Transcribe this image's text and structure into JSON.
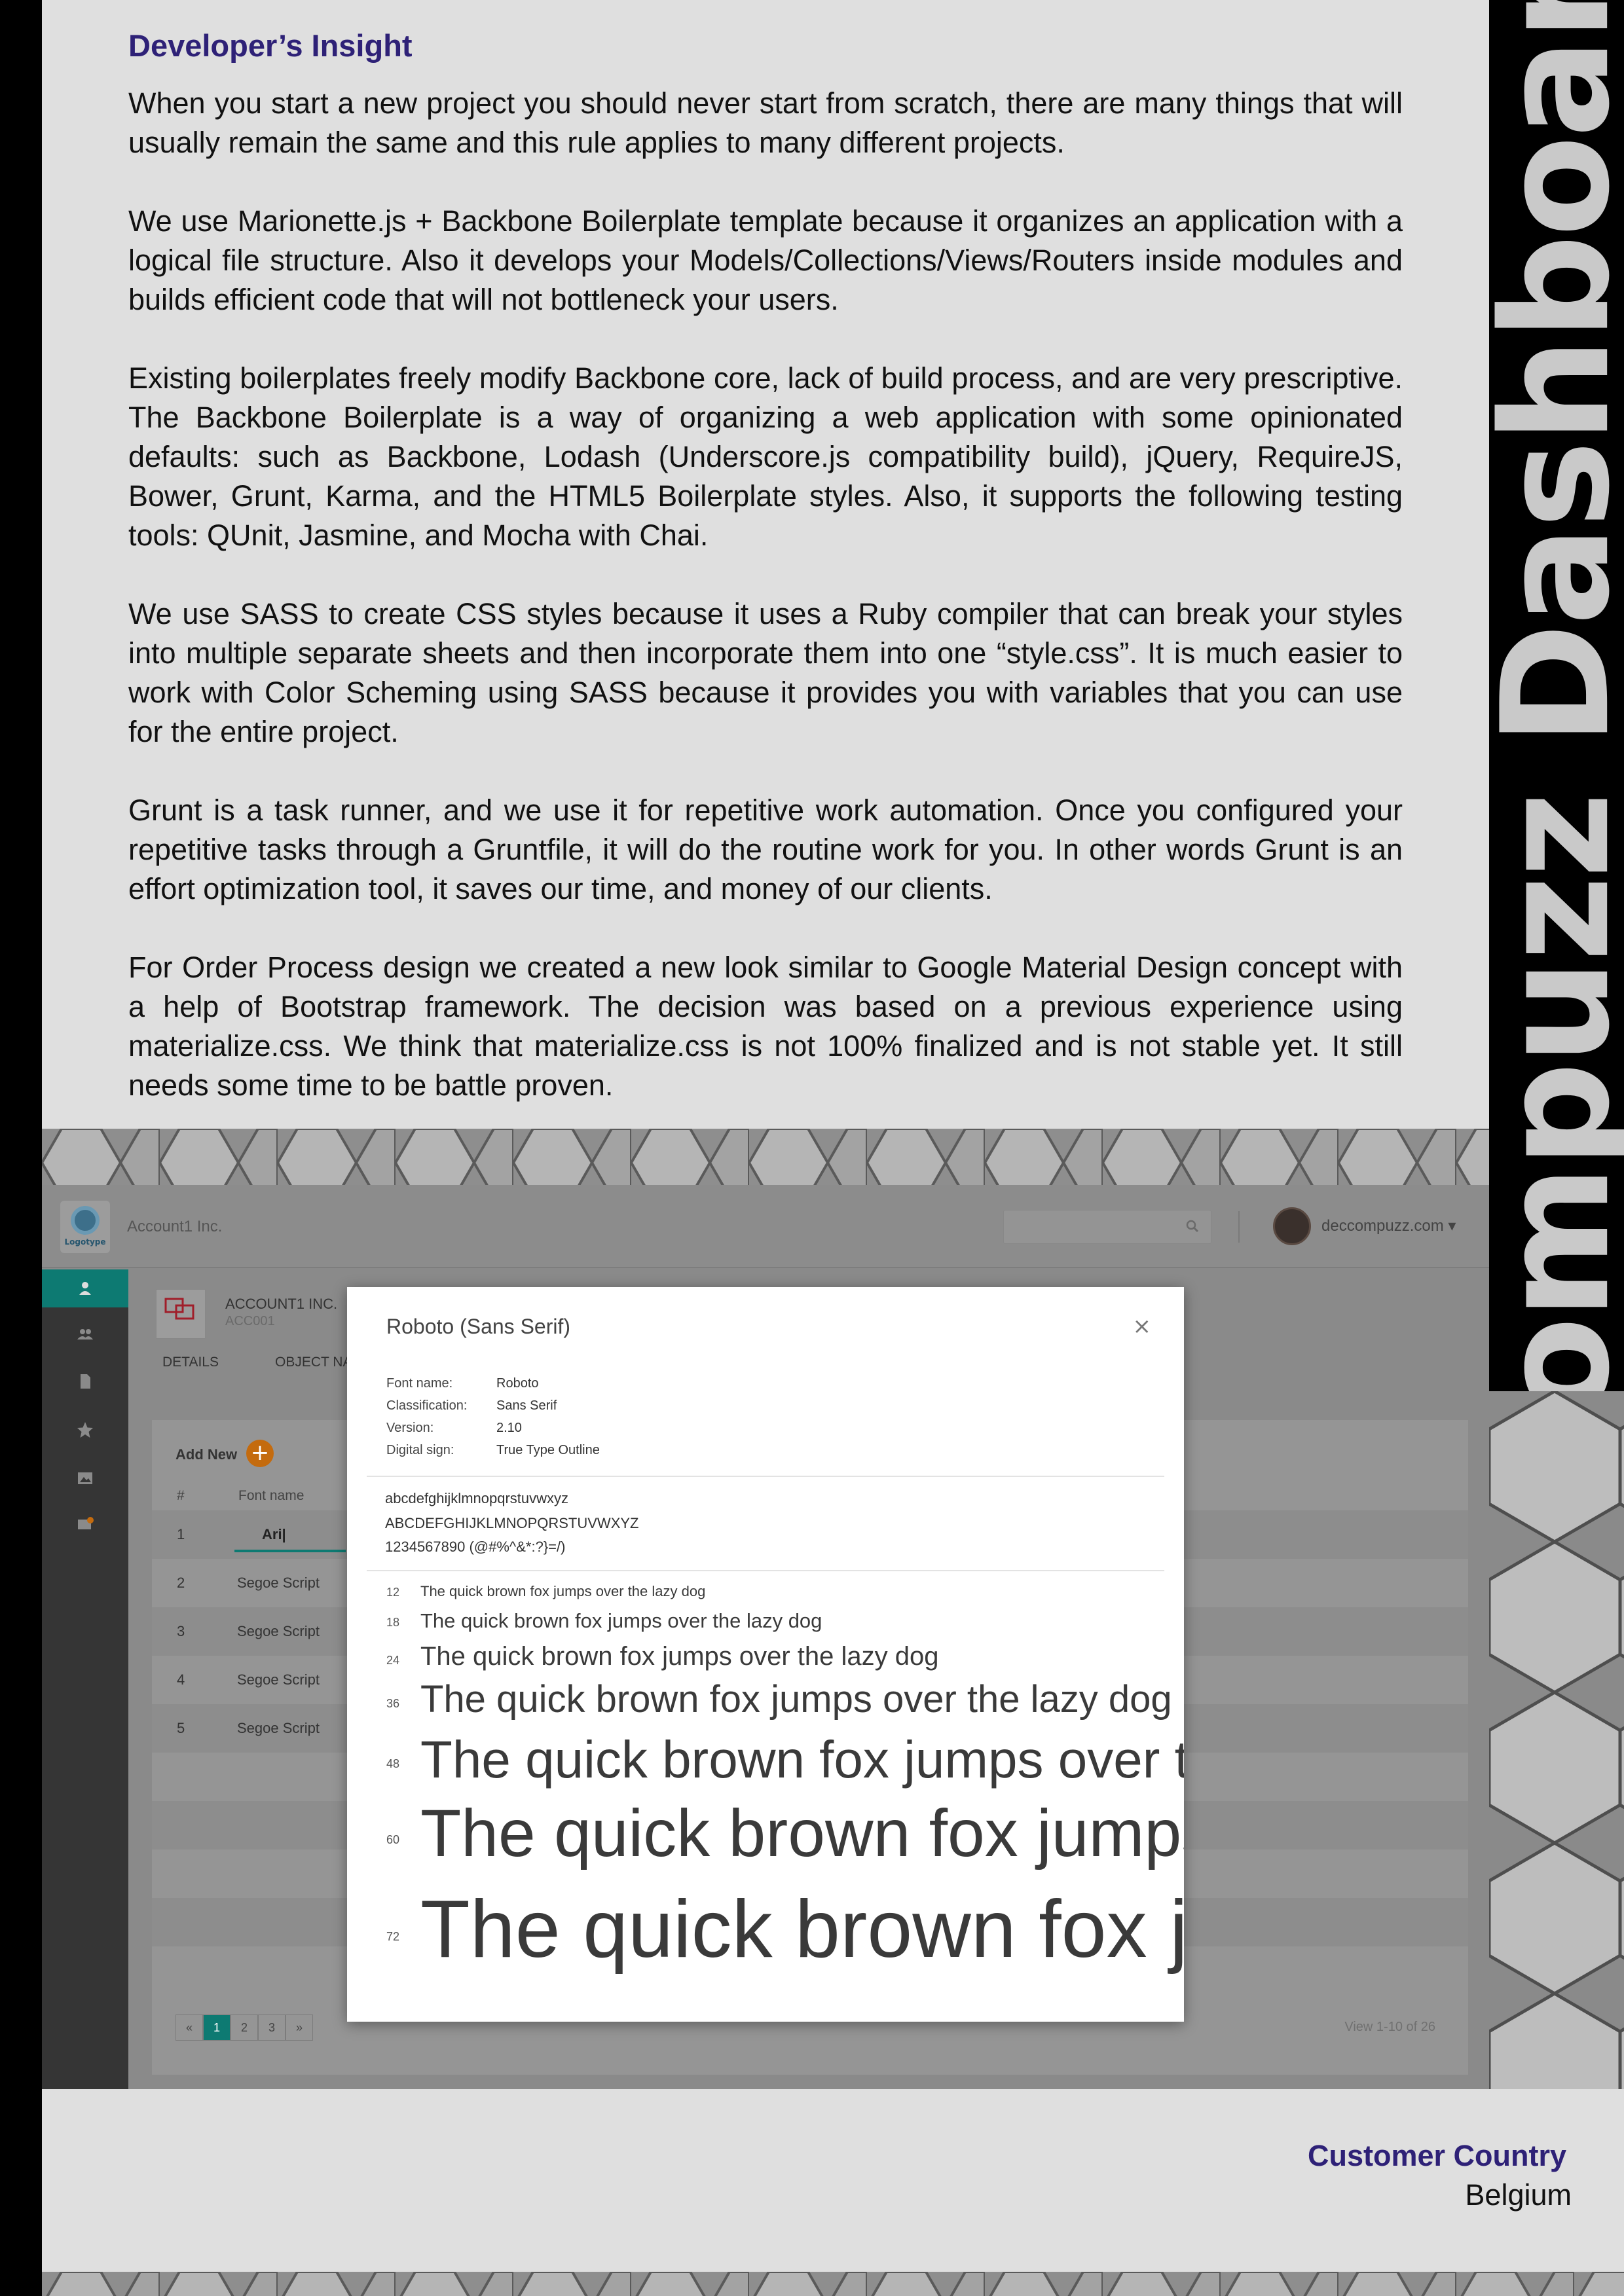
{
  "side_title": "Compuzz Dashboard",
  "insight": {
    "heading": "Developer’s Insight",
    "paragraphs": [
      "When you start a new project you should never start from scratch, there are many things that will usually remain the same and this rule applies to many different projects.",
      "We use Marionette.js + Backbone Boilerplate template because it organizes an application with a logical file structure. Also it develops your Models/Collections/Views/Routers inside modules and builds efficient code that will not bottleneck your users.",
      "Existing boilerplates freely modify Backbone core, lack of build process, and are very prescriptive. The Backbone Boilerplate is a way of organizing a web application with some opinionated defaults: such as Backbone, Lodash (Underscore.js compatibility build), jQuery, RequireJS, Bower, Grunt, Karma, and the HTML5 Boilerplate styles. Also, it supports the following testing tools: QUnit, Jasmine, and Mocha with Chai.",
      "We use SASS to create CSS styles because it uses a Ruby compiler that can break your styles into multiple separate sheets and then incorporate them into one “style.css”. It is much easier to work with Color Scheming using SASS because it provides you with variables that you can use for the entire project.",
      "Grunt is a task runner, and we use it for repetitive work automation. Once you configured your repetitive tasks through a Gruntfile, it will do the routine work for you. In other words Grunt is an effort optimization tool, it saves our time, and money of our clients.",
      "For Order Process design we created a new look similar to Google Material Design concept with a help of Bootstrap framework. The decision was based on a previous experience using materialize.css. We think that  materialize.css is not 100% finalized and is not stable yet. It still needs some time to be battle proven."
    ]
  },
  "dashboard": {
    "logo_text": "Logotype",
    "account_name": "Account1 Inc.",
    "user_name": "deccompuzz.com ▾",
    "account_title": "ACCOUNT1 INC.",
    "account_code": "ACC001",
    "tabs": [
      "DETAILS",
      "OBJECT NA"
    ],
    "add_new": "Add New",
    "columns": [
      "#",
      "Font name"
    ],
    "input_value": "Ari|",
    "rows": [
      {
        "num": "1",
        "font": ""
      },
      {
        "num": "2",
        "font": "Segoe Script"
      },
      {
        "num": "3",
        "font": "Segoe Script"
      },
      {
        "num": "4",
        "font": "Segoe Script"
      },
      {
        "num": "5",
        "font": "Segoe Script"
      }
    ],
    "pagination": [
      "«",
      "1",
      "2",
      "3",
      "»"
    ],
    "view_count": "View 1-10 of 26",
    "colors": {
      "accent": "#0d7a72",
      "add_button": "#c46b0e"
    }
  },
  "modal": {
    "title": "Roboto (Sans Serif)",
    "close": "×",
    "info": [
      {
        "label": "Font name:",
        "value": "Roboto"
      },
      {
        "label": "Classification:",
        "value": "Sans Serif"
      },
      {
        "label": "Version:",
        "value": "2.10"
      },
      {
        "label": "Digital sign:",
        "value": "True Type Outline"
      }
    ],
    "charset": [
      "abcdefghijklmnopqrstuvwxyz",
      "ABCDEFGHIJKLMNOPQRSTUVWXYZ",
      "1234567890 (@#%^&*:?}=/)"
    ],
    "samples": [
      {
        "size": "12",
        "text": "The quick brown fox jumps over the lazy dog"
      },
      {
        "size": "18",
        "text": "The quick brown fox jumps over the lazy dog"
      },
      {
        "size": "24",
        "text": "The quick brown fox jumps over the lazy dog"
      },
      {
        "size": "36",
        "text": "The quick brown fox jumps over the lazy dog"
      },
      {
        "size": "48",
        "text": "The quick brown fox jumps over the lazy dog"
      },
      {
        "size": "60",
        "text": "The quick brown fox jumps over the lazy dog"
      },
      {
        "size": "72",
        "text": "The quick brown fox jumps over the lazy dog"
      }
    ]
  },
  "customer": {
    "label": "Customer Country",
    "value": "Belgium"
  }
}
